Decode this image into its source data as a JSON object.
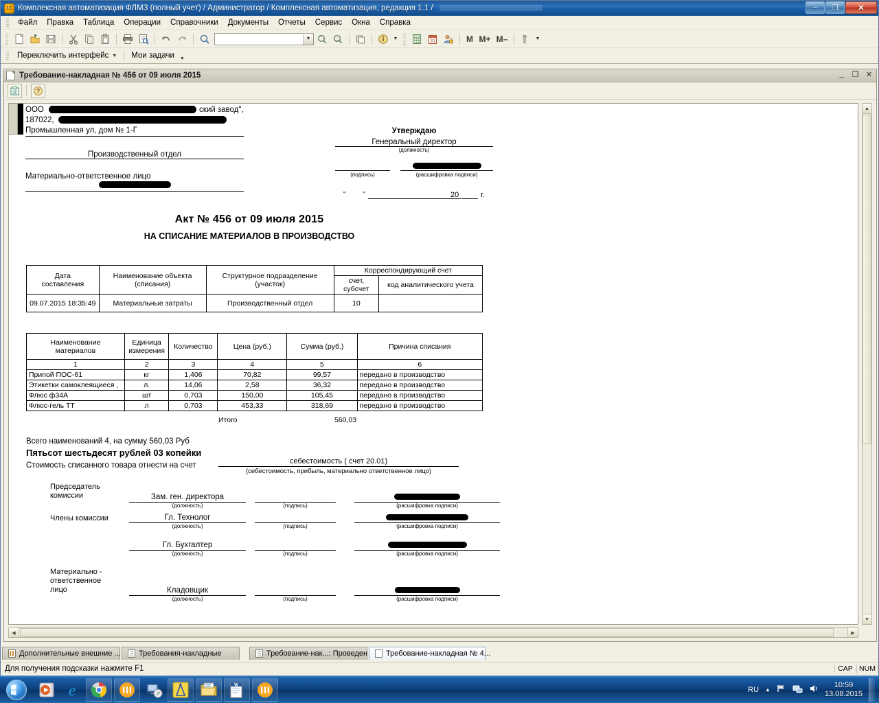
{
  "window": {
    "title": "Комплексная автоматизация ФЛМЗ (полный учет) / Администратор /  Комплексная автоматизация, редакция 1.1 /",
    "minimize": "–",
    "maximize": "❐",
    "close": "✕"
  },
  "menubar": {
    "items": [
      {
        "label": "Файл"
      },
      {
        "label": "Правка"
      },
      {
        "label": "Таблица"
      },
      {
        "label": "Операции"
      },
      {
        "label": "Справочники"
      },
      {
        "label": "Документы"
      },
      {
        "label": "Отчеты"
      },
      {
        "label": "Сервис"
      },
      {
        "label": "Окна"
      },
      {
        "label": "Справка"
      }
    ]
  },
  "toolbar": {
    "icons": [
      "new-document-icon",
      "open-folder-icon",
      "save-icon",
      "cut-icon",
      "copy-icon",
      "paste-icon",
      "print-icon",
      "print-preview-icon",
      "undo-icon",
      "redo-icon",
      "search-icon"
    ],
    "search_value": "",
    "icons2": [
      "find-next-icon",
      "find-prev-icon",
      "copy-window-icon",
      "info-icon",
      "calculator-icon",
      "calendar-icon",
      "user-lock-icon"
    ],
    "memory_buttons": [
      "M",
      "M+",
      "M–"
    ],
    "tools_icon": "wrench-icon"
  },
  "toolbar2": {
    "switch_interface": "Переключить интерфейс",
    "my_tasks": "Мои задачи"
  },
  "doc_window": {
    "title": "Требование-накладная № 456 от 09 июля 2015",
    "icon": "document-icon",
    "toolbar_icons": [
      "save-to-file-icon",
      "help-icon"
    ],
    "minimize": "_",
    "restore": "❐",
    "close": "✕"
  },
  "form": {
    "org": {
      "prefix": "ООО",
      "line1_suffix": "ский   завод\",",
      "line2_prefix": "187022,",
      "line3": "Промышленная ул, дом № 1-Г"
    },
    "department": "Производственный отдел",
    "responsible_label": "Материально-ответственное лицо",
    "approve": {
      "header": "Утверждаю",
      "position": "Генеральный директор",
      "position_caption": "(должность)",
      "signature_caption": "(подпись)",
      "decode_caption": "(расшифровка подписи)",
      "date_quote_open": "\"",
      "date_quote_close": "\"",
      "date_year": "20",
      "date_suffix": "г."
    },
    "title1": "Акт  № 456 от 09 июля 2015",
    "title2": "НА СПИСАНИЕ МАТЕРИАЛОВ В ПРОИЗВОДСТВО",
    "table1": {
      "headers": {
        "date": "Дата\nсоставления",
        "date_l1": "Дата",
        "date_l2": "составления",
        "object_l1": "Наименование объекта",
        "object_l2": "(списания)",
        "unit_l1": "Структурное подразделение",
        "unit_l2": "(участок)",
        "corr_account": "Корреспондирующий счет",
        "account_l1": "счет,",
        "account_l2": "субсчет",
        "analytic": "код аналитического учета"
      },
      "row": {
        "date": "09.07.2015 18:35:49",
        "object": "Материальные затраты",
        "unit": "Производственный отдел",
        "account": "10",
        "analytic": ""
      }
    },
    "table2": {
      "headers": {
        "name_l1": "Наименование",
        "name_l2": "материалов",
        "unit_l1": "Единица",
        "unit_l2": "измерения",
        "qty": "Количество",
        "price": "Цена (руб.)",
        "sum": "Сумма (руб.)",
        "reason": "Причина списания"
      },
      "numbers": [
        "1",
        "2",
        "3",
        "4",
        "5",
        "6"
      ],
      "rows": [
        {
          "name": "Припой ПОС-61",
          "unit": "кг",
          "qty": "1,406",
          "price": "70,82",
          "sum": "99,57",
          "reason": "передано в производство"
        },
        {
          "name": "Этикетки самоклеящиеся ,",
          "unit": "л.",
          "qty": "14,06",
          "price": "2,58",
          "sum": "36,32",
          "reason": "передано в производство"
        },
        {
          "name": "Флюс ф34А",
          "unit": "шт",
          "qty": "0,703",
          "price": "150,00",
          "sum": "105,45",
          "reason": "передано в производство"
        },
        {
          "name": "Флюс-гель ТТ",
          "unit": "л",
          "qty": "0,703",
          "price": "453,33",
          "sum": "318,69",
          "reason": "передано в производство"
        }
      ],
      "total_label": "Итого",
      "total_value": "560,03"
    },
    "summary": {
      "line1": "Всего наименований 4, на сумму 560,03 Руб",
      "line2": "Пятьсот шестьдесят рублей 03 копейки",
      "line3": "Стоимость списанного товара отнести на счет",
      "account_value": "себестоимость ( счет 20.01)",
      "account_caption": "(себестоимость, прибыль, материально ответственное лицо)"
    },
    "signatures": {
      "caption_position": "(должность)",
      "caption_signature": "(подпись)",
      "caption_decode": "(расшифровка подписи)",
      "rows": [
        {
          "label_l1": "Председатель",
          "label_l2": "комиссии",
          "position": "Зам. ген. директора"
        },
        {
          "label_l1": "Члены комиссии",
          "label_l2": "",
          "position": "Гл. Технолог"
        },
        {
          "label_l1": "",
          "label_l2": "",
          "position": "Гл. Бухгалтер"
        },
        {
          "label_l1": "Материально -",
          "label_l2": "ответственное",
          "label_l3": "лицо",
          "position": "Кладовщик"
        }
      ]
    }
  },
  "window_tabs": [
    {
      "label": "Дополнительные внешние ...",
      "icon": "grid-icon",
      "active": false
    },
    {
      "label": "Требования-накладные",
      "icon": "list-icon",
      "active": false
    },
    {
      "label": "Требование-нак...: Проведен",
      "icon": "list-icon",
      "active": false
    },
    {
      "label": "Требование-накладная № 4...",
      "icon": "document-icon",
      "active": true
    }
  ],
  "statusbar": {
    "hint": "Для получения подсказки нажмите F1",
    "indicators": [
      "CAP",
      "NUM"
    ]
  },
  "taskbar": {
    "start": "start-orb",
    "buttons": [
      {
        "name": "media-player-icon"
      },
      {
        "name": "internet-explorer-icon"
      },
      {
        "name": "google-chrome-icon"
      },
      {
        "name": "1c-enterprise-icon"
      },
      {
        "name": "remote-desktop-icon"
      },
      {
        "name": "kompas-cad-icon"
      },
      {
        "name": "file-explorer-icon"
      },
      {
        "name": "microsoft-word-icon"
      },
      {
        "name": "1c-enterprise-icon-2"
      }
    ],
    "tray": {
      "language": "RU",
      "icons": [
        "show-hidden-icon",
        "network-flag-icon",
        "network-icon",
        "volume-icon"
      ],
      "time": "10:59",
      "date": "13.08.2015"
    }
  },
  "colors": {
    "title_blue": "#1c5ea8",
    "app_bg": "#f2f0e4",
    "accent": "#2b70b8"
  }
}
